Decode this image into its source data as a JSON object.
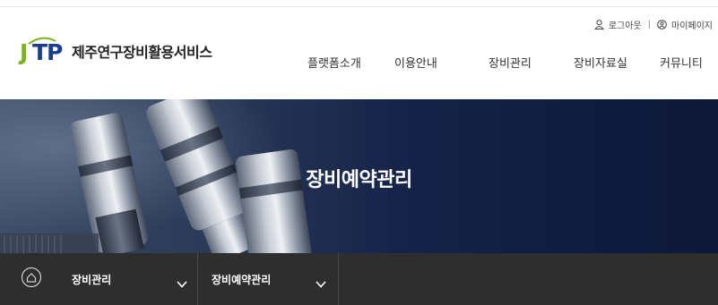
{
  "util": {
    "logout_label": "로그아웃",
    "separator": "|",
    "mypage_label": "마이페이지"
  },
  "logo": {
    "mark_j": "J",
    "mark_tp": "TP",
    "title": "제주연구장비활용서비스"
  },
  "nav": {
    "items": [
      {
        "label": "플랫폼소개"
      },
      {
        "label": "이용안내"
      },
      {
        "label": "장비관리"
      },
      {
        "label": "장비자료실"
      },
      {
        "label": "커뮤니티"
      }
    ]
  },
  "hero": {
    "title": "장비예약관리"
  },
  "breadcrumb": {
    "home_icon": "home-icon",
    "level1": "장비관리",
    "level2": "장비예약관리"
  },
  "colors": {
    "logo_green": "#7ab51d",
    "logo_blue": "#1a3d8f",
    "hero_bg": "#16244a",
    "breadcrumb_bg": "#2e2e2e"
  }
}
